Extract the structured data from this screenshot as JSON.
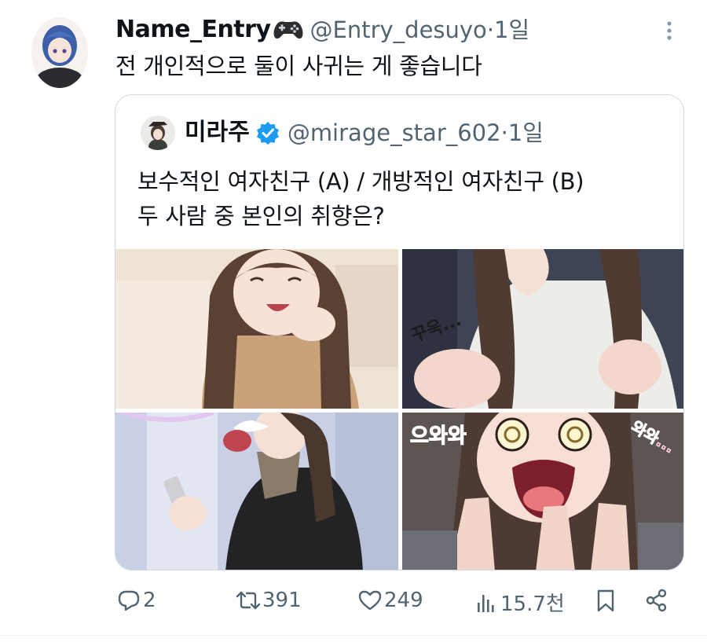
{
  "post": {
    "display_name": "Name_Entry",
    "handle": "@Entry_desuyo",
    "separator": " · ",
    "time": "1일",
    "text": "전 개인적으로 둘이 사귀는 게 좋습니다"
  },
  "quote": {
    "display_name": "미라주",
    "handle": "@mirage_star_602",
    "separator": " · ",
    "time": "1일",
    "text_line1": "보수적인 여자친구 (A) / 개방적인 여자친구 (B)",
    "text_line2": "두 사람 중 본인의 취향은?",
    "comic_sfx": {
      "panel2": "꾸욱...",
      "panel4_left": "으와와",
      "panel4_right": "와와..."
    }
  },
  "actions": {
    "replies": "2",
    "reposts": "391",
    "likes": "249",
    "views": "15.7천"
  },
  "colors": {
    "text": "#0f1419",
    "secondary": "#536471",
    "verified": "#1d9bf0",
    "border": "#cfd9de"
  },
  "icons": [
    "gamepad-icon",
    "more-icon",
    "verified-icon",
    "reply-icon",
    "repost-icon",
    "like-icon",
    "views-icon",
    "bookmark-icon",
    "share-icon"
  ]
}
